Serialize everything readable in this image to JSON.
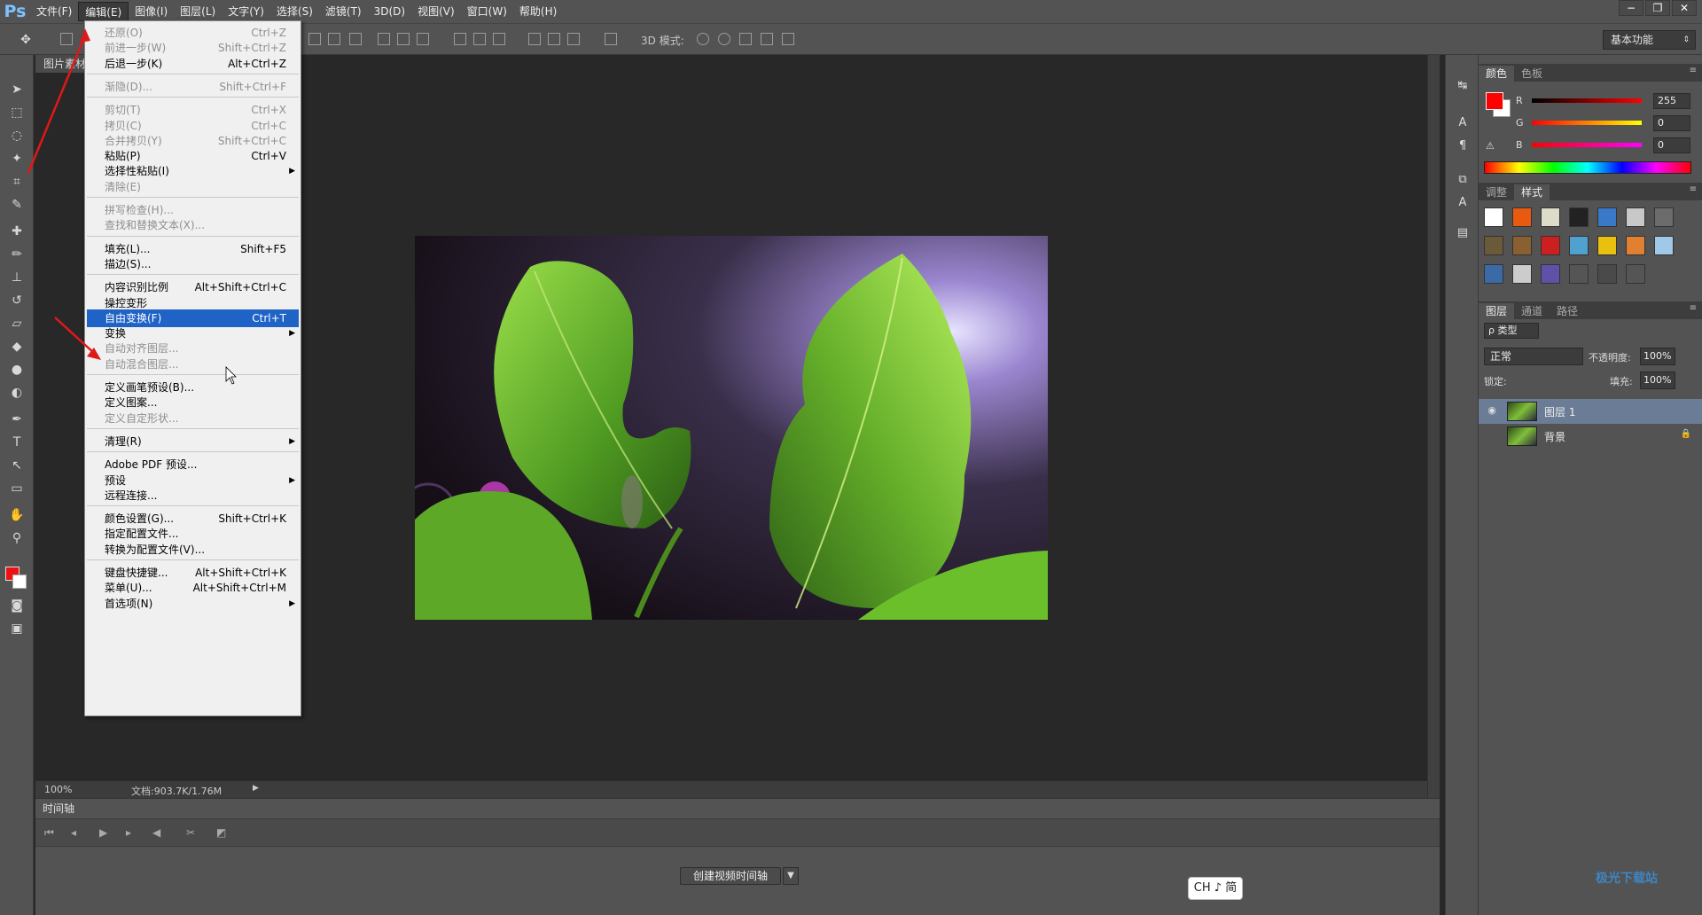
{
  "app": {
    "logo": "Ps"
  },
  "menubar": {
    "items": [
      "文件(F)",
      "编辑(E)",
      "图像(I)",
      "图层(L)",
      "文字(Y)",
      "选择(S)",
      "滤镜(T)",
      "3D(D)",
      "视图(V)",
      "窗口(W)",
      "帮助(H)"
    ],
    "active_index": 1,
    "window_controls": [
      "−",
      "❐",
      "✕"
    ]
  },
  "optionsbar": {
    "mode_3d_label": "3D 模式:",
    "workspace": "基本功能"
  },
  "document": {
    "tab_title": "图片素材",
    "zoom": "100%",
    "doc_info": "文档:903.7K/1.76M"
  },
  "timeline": {
    "title": "时间轴",
    "create_button": "创建视频时间轴"
  },
  "ime": {
    "label": "CH ♪ 简"
  },
  "color_panel": {
    "tabs": [
      "颜色",
      "色板"
    ],
    "channels": [
      {
        "label": "R",
        "value": "255"
      },
      {
        "label": "G",
        "value": "0"
      },
      {
        "label": "B",
        "value": "0"
      }
    ],
    "foreground": "#ff0000"
  },
  "adjust_panel": {
    "tabs": [
      "调整",
      "样式"
    ]
  },
  "layers_panel": {
    "tabs": [
      "图层",
      "通道",
      "路径"
    ],
    "kind_filter": "ρ 类型",
    "blend_mode": "正常",
    "opacity_label": "不透明度:",
    "opacity_value": "100%",
    "lock_label": "锁定:",
    "fill_label": "填充:",
    "fill_value": "100%",
    "layers": [
      {
        "name": "图层 1",
        "selected": true,
        "visible": true
      },
      {
        "name": "背景",
        "selected": false,
        "visible": false,
        "locked": true
      }
    ]
  },
  "edit_menu": {
    "items": [
      {
        "label": "还原(O)",
        "shortcut": "Ctrl+Z",
        "disabled": true
      },
      {
        "label": "前进一步(W)",
        "shortcut": "Shift+Ctrl+Z",
        "disabled": true
      },
      {
        "label": "后退一步(K)",
        "shortcut": "Alt+Ctrl+Z",
        "disabled": false
      },
      {
        "sep": true
      },
      {
        "label": "渐隐(D)...",
        "shortcut": "Shift+Ctrl+F",
        "disabled": true
      },
      {
        "sep": true
      },
      {
        "label": "剪切(T)",
        "shortcut": "Ctrl+X",
        "disabled": true
      },
      {
        "label": "拷贝(C)",
        "shortcut": "Ctrl+C",
        "disabled": true
      },
      {
        "label": "合并拷贝(Y)",
        "shortcut": "Shift+Ctrl+C",
        "disabled": true
      },
      {
        "label": "粘贴(P)",
        "shortcut": "Ctrl+V",
        "disabled": false
      },
      {
        "label": "选择性粘贴(I)",
        "shortcut": "",
        "disabled": false,
        "submenu": true
      },
      {
        "label": "清除(E)",
        "shortcut": "",
        "disabled": true
      },
      {
        "sep": true
      },
      {
        "label": "拼写检查(H)...",
        "shortcut": "",
        "disabled": true
      },
      {
        "label": "查找和替换文本(X)...",
        "shortcut": "",
        "disabled": true
      },
      {
        "sep": true
      },
      {
        "label": "填充(L)...",
        "shortcut": "Shift+F5",
        "disabled": false
      },
      {
        "label": "描边(S)...",
        "shortcut": "",
        "disabled": false
      },
      {
        "sep": true
      },
      {
        "label": "内容识别比例",
        "shortcut": "Alt+Shift+Ctrl+C",
        "disabled": false
      },
      {
        "label": "操控变形",
        "shortcut": "",
        "disabled": false
      },
      {
        "label": "自由变换(F)",
        "shortcut": "Ctrl+T",
        "disabled": false,
        "highlight": true
      },
      {
        "label": "变换",
        "shortcut": "",
        "disabled": false,
        "submenu": true
      },
      {
        "label": "自动对齐图层...",
        "shortcut": "",
        "disabled": true
      },
      {
        "label": "自动混合图层...",
        "shortcut": "",
        "disabled": true
      },
      {
        "sep": true
      },
      {
        "label": "定义画笔预设(B)...",
        "shortcut": "",
        "disabled": false
      },
      {
        "label": "定义图案...",
        "shortcut": "",
        "disabled": false
      },
      {
        "label": "定义自定形状...",
        "shortcut": "",
        "disabled": true
      },
      {
        "sep": true
      },
      {
        "label": "清理(R)",
        "shortcut": "",
        "disabled": false,
        "submenu": true
      },
      {
        "sep": true
      },
      {
        "label": "Adobe PDF 预设...",
        "shortcut": "",
        "disabled": false
      },
      {
        "label": "预设",
        "shortcut": "",
        "disabled": false,
        "submenu": true
      },
      {
        "label": "远程连接...",
        "shortcut": "",
        "disabled": false
      },
      {
        "sep": true
      },
      {
        "label": "颜色设置(G)...",
        "shortcut": "Shift+Ctrl+K",
        "disabled": false
      },
      {
        "label": "指定配置文件...",
        "shortcut": "",
        "disabled": false
      },
      {
        "label": "转换为配置文件(V)...",
        "shortcut": "",
        "disabled": false
      },
      {
        "sep": true
      },
      {
        "label": "键盘快捷键...",
        "shortcut": "Alt+Shift+Ctrl+K",
        "disabled": false
      },
      {
        "label": "菜单(U)...",
        "shortcut": "Alt+Shift+Ctrl+M",
        "disabled": false
      },
      {
        "label": "首选项(N)",
        "shortcut": "",
        "disabled": false,
        "submenu": true
      }
    ]
  },
  "watermark": "极光下载站"
}
